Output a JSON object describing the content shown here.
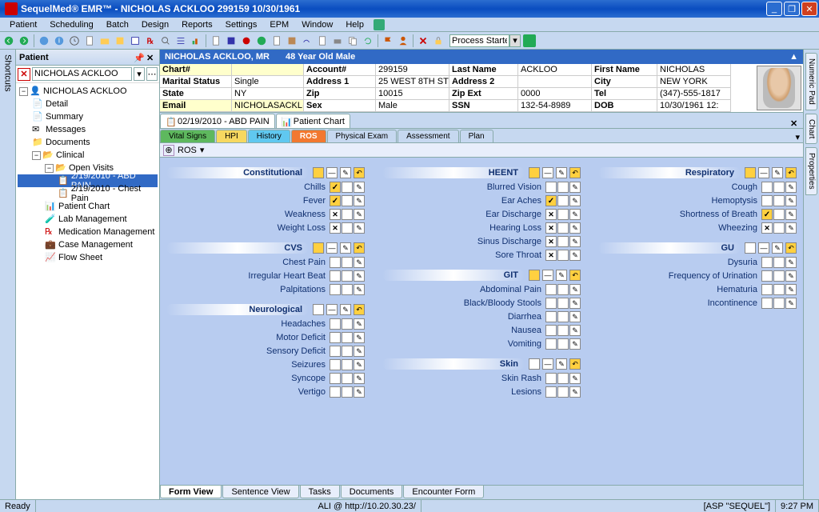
{
  "app": {
    "title": "SequelMed® EMR™ - NICHOLAS ACKLOO  299159  10/30/1961"
  },
  "menu": [
    "Patient",
    "Scheduling",
    "Batch",
    "Design",
    "Reports",
    "Settings",
    "EPM",
    "Window",
    "Help"
  ],
  "toolbar": {
    "process": "Process Started"
  },
  "leftpanel": {
    "title": "Patient",
    "current": "NICHOLAS ACKLOO",
    "tree": {
      "root": "NICHOLAS ACKLOO",
      "detail": "Detail",
      "summary": "Summary",
      "messages": "Messages",
      "documents": "Documents",
      "clinical": "Clinical",
      "openvisits": "Open Visits",
      "visit1": "2/19/2010 - ABD PAIN",
      "visit2": "2/19/2010 - Chest Pain",
      "patientchart": "Patient Chart",
      "labmgmt": "Lab Management",
      "medmgmt": "Medication Management",
      "casemgmt": "Case Management",
      "flowsheet": "Flow Sheet"
    }
  },
  "patient": {
    "name": "NICHOLAS   ACKLOO, MR",
    "age": "48 Year Old Male",
    "labels": {
      "chart": "Chart#",
      "marital": "Marital Status",
      "state": "State",
      "email": "Email",
      "account": "Account#",
      "addr1": "Address 1",
      "zip": "Zip",
      "sex": "Sex",
      "lastname": "Last Name",
      "addr2": "Address 2",
      "zipext": "Zip Ext",
      "ssn": "SSN",
      "firstname": "First Name",
      "city": "City",
      "tel": "Tel",
      "dob": "DOB"
    },
    "values": {
      "chart": "",
      "marital": "Single",
      "state": "NY",
      "email": "NICHOLASACKL@A",
      "account": "299159",
      "addr1": "25 WEST 8TH ST",
      "zip": "10015",
      "sex": "Male",
      "lastname": "ACKLOO",
      "addr2": "",
      "zipext": "0000",
      "ssn": "132-54-8989",
      "firstname": "NICHOLAS",
      "city": "NEW YORK",
      "tel": "(347)-555-1817",
      "dob": "10/30/1961 12:"
    }
  },
  "doctabs": {
    "visit": "02/19/2010 - ABD PAIN",
    "chart": "Patient Chart"
  },
  "subtabs": {
    "vital": "Vital Signs",
    "hpi": "HPI",
    "history": "History",
    "ros": "ROS",
    "phys": "Physical Exam",
    "assess": "Assessment",
    "plan": "Plan"
  },
  "breadcrumb": "ROS",
  "ros": {
    "col1": [
      {
        "title": "Constitutional",
        "items": [
          "Chills",
          "Fever",
          "Weakness",
          "Weight Loss"
        ]
      },
      {
        "title": "CVS",
        "items": [
          "Chest Pain",
          "Irregular Heart Beat",
          "Palpitations"
        ]
      },
      {
        "title": "Neurological",
        "items": [
          "Headaches",
          "Motor Deficit",
          "Sensory Deficit",
          "Seizures",
          "Syncope",
          "Vertigo"
        ]
      }
    ],
    "col2": [
      {
        "title": "HEENT",
        "items": [
          "Blurred Vision",
          "Ear Aches",
          "Ear Discharge",
          "Hearing Loss",
          "Sinus Discharge",
          "Sore Throat"
        ]
      },
      {
        "title": "GIT",
        "items": [
          "Abdominal Pain",
          "Black/Bloody Stools",
          "Diarrhea",
          "Nausea",
          "Vomiting"
        ]
      },
      {
        "title": "Skin",
        "items": [
          "Skin Rash",
          "Lesions"
        ]
      }
    ],
    "col3": [
      {
        "title": "Respiratory",
        "items": [
          "Cough",
          "Hemoptysis",
          "Shortness of Breath",
          "Wheezing"
        ]
      },
      {
        "title": "GU",
        "items": [
          "Dysuria",
          "Frequency of Urination",
          "Hematuria",
          "Incontinence"
        ]
      }
    ]
  },
  "btabs": [
    "Form View",
    "Sentence View",
    "Tasks",
    "Documents",
    "Encounter Form"
  ],
  "righttabs": [
    "Numeric Pad",
    "Chart",
    "Properties"
  ],
  "sidetab": "Shortcuts",
  "status": {
    "ready": "Ready",
    "conn": "ALI @ http://10.20.30.23/",
    "db": "[ASP \"SEQUEL\"]",
    "time": "9:27 PM"
  }
}
